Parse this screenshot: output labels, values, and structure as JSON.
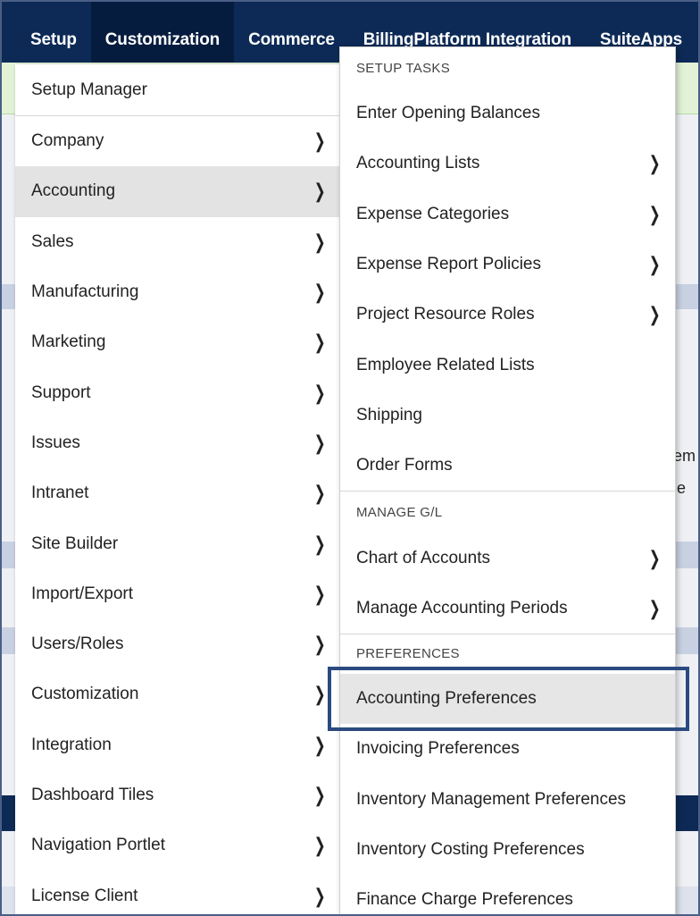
{
  "topnav": {
    "items": [
      {
        "label": "Setup"
      },
      {
        "label": "Customization"
      },
      {
        "label": "Commerce"
      },
      {
        "label": "BillingPlatform Integration"
      },
      {
        "label": "SuiteApps"
      }
    ]
  },
  "background": {
    "fragment_1": "em",
    "fragment_2": "e"
  },
  "setup_menu": {
    "setup_manager": "Setup Manager",
    "items": [
      {
        "label": "Company"
      },
      {
        "label": "Accounting"
      },
      {
        "label": "Sales"
      },
      {
        "label": "Manufacturing"
      },
      {
        "label": "Marketing"
      },
      {
        "label": "Support"
      },
      {
        "label": "Issues"
      },
      {
        "label": "Intranet"
      },
      {
        "label": "Site Builder"
      },
      {
        "label": "Import/Export"
      },
      {
        "label": "Users/Roles"
      },
      {
        "label": "Customization"
      },
      {
        "label": "Integration"
      },
      {
        "label": "Dashboard Tiles"
      },
      {
        "label": "Navigation Portlet"
      },
      {
        "label": "License Client"
      }
    ],
    "selected": "Accounting"
  },
  "accounting_submenu": {
    "setup_tasks": {
      "heading": "SETUP TASKS",
      "items": [
        {
          "label": "Enter Opening Balances"
        },
        {
          "label": "Accounting Lists"
        },
        {
          "label": "Expense Categories"
        },
        {
          "label": "Expense Report Policies"
        },
        {
          "label": "Project Resource Roles"
        },
        {
          "label": "Employee Related Lists"
        },
        {
          "label": "Shipping"
        },
        {
          "label": "Order Forms"
        }
      ]
    },
    "manage_gl": {
      "heading": "MANAGE G/L",
      "items": [
        {
          "label": "Chart of Accounts"
        },
        {
          "label": "Manage Accounting Periods"
        }
      ]
    },
    "preferences": {
      "heading": "PREFERENCES",
      "items": [
        {
          "label": "Accounting Preferences"
        },
        {
          "label": "Invoicing Preferences"
        },
        {
          "label": "Inventory Management Preferences"
        },
        {
          "label": "Inventory Costing Preferences"
        },
        {
          "label": "Finance Charge Preferences"
        }
      ]
    }
  },
  "colors": {
    "nav_background": "#0d2a56",
    "callout_border": "#2b4a80",
    "selected_row": "#e3e3e3"
  }
}
